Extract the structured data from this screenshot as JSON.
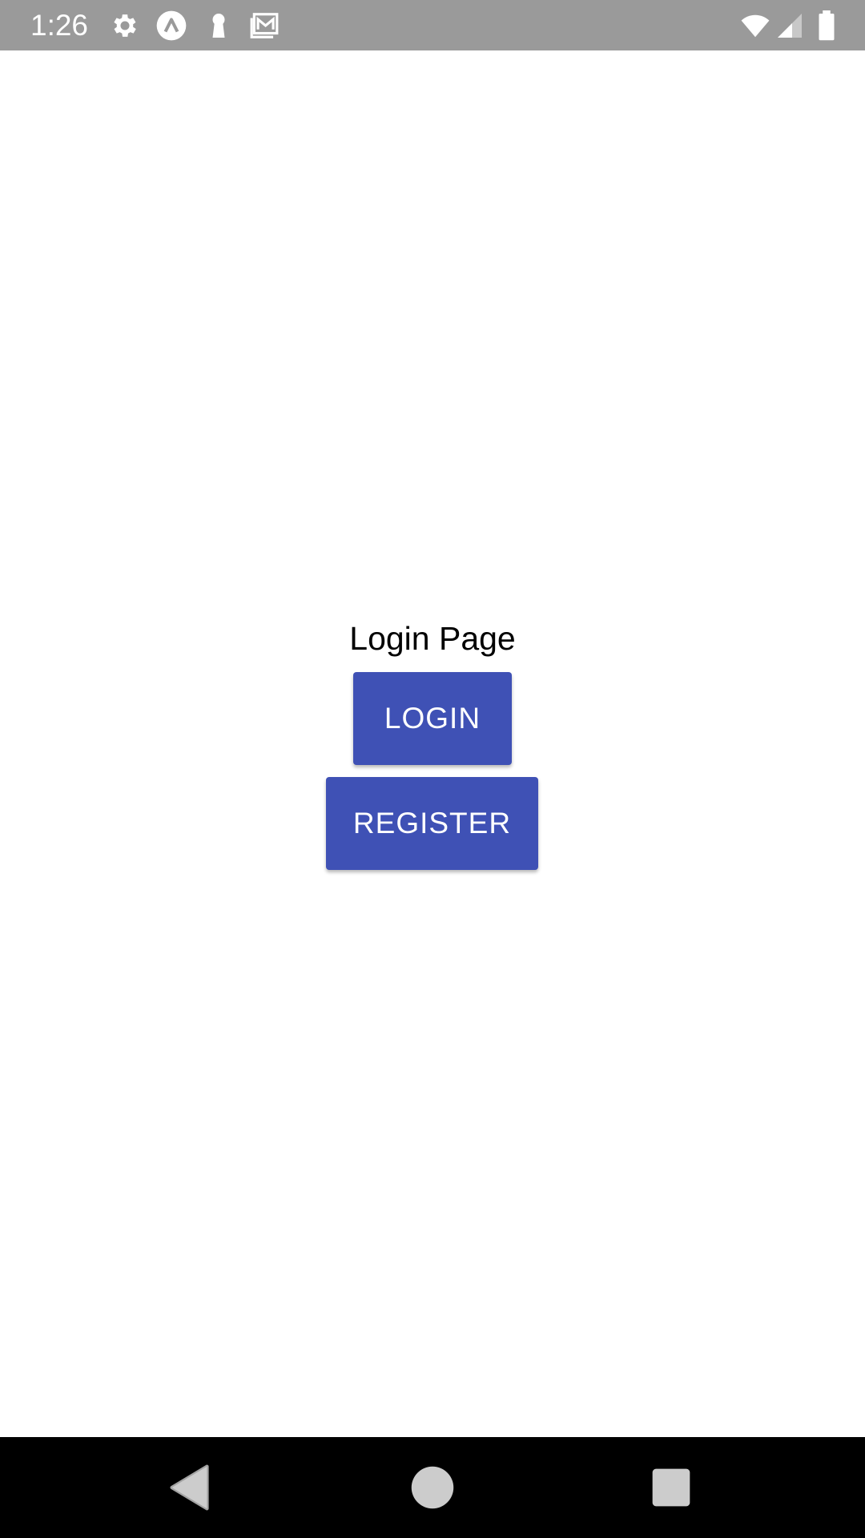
{
  "status_bar": {
    "time": "1:26",
    "icons": [
      "gear-icon",
      "app-icon",
      "keyhole-icon",
      "gmail-icon",
      "wifi-icon",
      "signal-icon",
      "battery-icon"
    ]
  },
  "main": {
    "title": "Login Page",
    "login_label": "LOGIN",
    "register_label": "REGISTER"
  },
  "nav_bar": {
    "buttons": [
      "back-icon",
      "home-icon",
      "recents-icon"
    ]
  },
  "colors": {
    "status_bar": "#9a9a9a",
    "button": "#3f51b5",
    "nav_bar": "#000000"
  }
}
